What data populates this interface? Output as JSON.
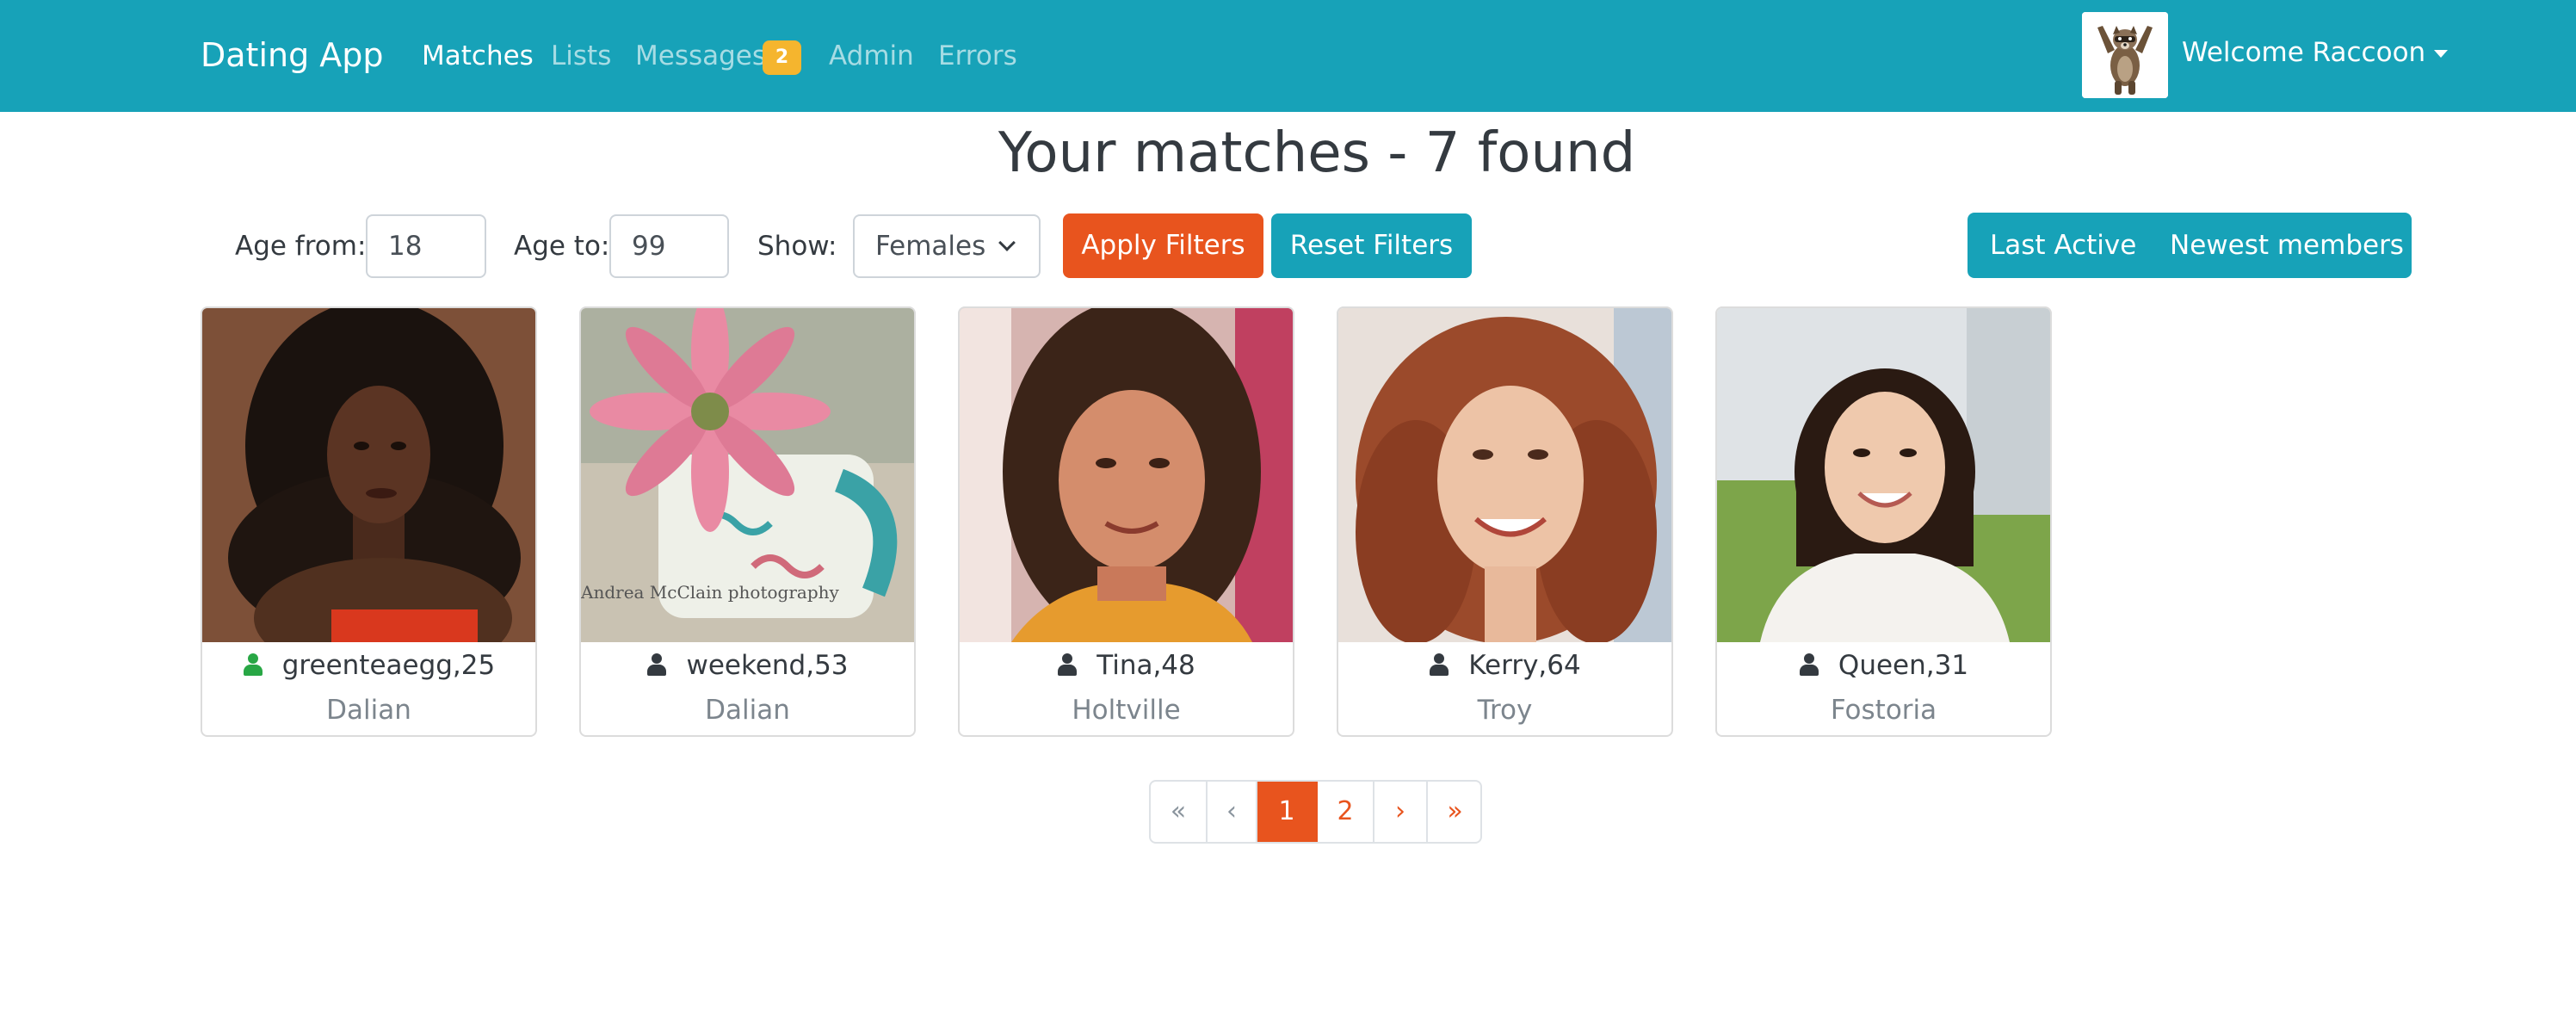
{
  "navbar": {
    "brand": "Dating App",
    "links": [
      {
        "label": "Matches",
        "active": true
      },
      {
        "label": "Lists",
        "active": false
      },
      {
        "label": "Messages",
        "active": false,
        "badge": "2"
      },
      {
        "label": "Admin",
        "active": false
      },
      {
        "label": "Errors",
        "active": false
      }
    ],
    "welcome": "Welcome Raccoon",
    "avatar_icon": "raccoon-avatar"
  },
  "page": {
    "title": "Your matches - 7 found"
  },
  "filters": {
    "age_from_label": "Age from:",
    "age_from_value": "18",
    "age_to_label": "Age to:",
    "age_to_value": "99",
    "show_label": "Show:",
    "show_value": "Females",
    "apply_label": "Apply Filters",
    "reset_label": "Reset Filters",
    "sort_options": [
      "Last Active",
      "Newest members"
    ]
  },
  "members": [
    {
      "name": "greenteaegg,25",
      "city": "Dalian",
      "online": true
    },
    {
      "name": "weekend,53",
      "city": "Dalian",
      "online": false
    },
    {
      "name": "Tina,48",
      "city": "Holtville",
      "online": false
    },
    {
      "name": "Kerry,64",
      "city": "Troy",
      "online": false
    },
    {
      "name": "Queen,31",
      "city": "Fostoria",
      "online": false
    }
  ],
  "photo_watermark": "Andrea McClain photography",
  "pagination": {
    "items": [
      "«",
      "‹",
      "1",
      "2",
      "›",
      "»"
    ],
    "current": "1"
  },
  "colors": {
    "primary": "#17a2b8",
    "accent": "#e8541e",
    "badge": "#f5b52e",
    "online": "#28a745"
  }
}
